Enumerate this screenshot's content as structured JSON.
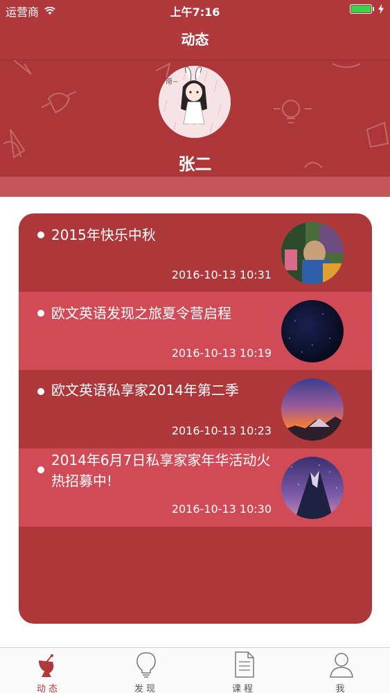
{
  "status_bar": {
    "carrier": "运营商",
    "time": "上午7:16",
    "battery_level": 1.0
  },
  "nav": {
    "title": "动态"
  },
  "profile": {
    "name": "张二"
  },
  "feed": [
    {
      "title": "2015年快乐中秋",
      "time": "2016-10-13 10:31"
    },
    {
      "title": "欧文英语发现之旅夏令营启程",
      "time": "2016-10-13 10:19"
    },
    {
      "title": "欧文英语私享家2014年第二季",
      "time": "2016-10-13 10:23"
    },
    {
      "title": "2014年6月7日私享家家年华活动火热招募中!",
      "time": "2016-10-13 10:30"
    }
  ],
  "tabs": [
    {
      "label": "动态",
      "icon": "satellite-dish-icon",
      "active": true
    },
    {
      "label": "发现",
      "icon": "lightbulb-icon",
      "active": false
    },
    {
      "label": "课程",
      "icon": "document-icon",
      "active": false
    },
    {
      "label": "我",
      "icon": "person-icon",
      "active": false
    }
  ],
  "colors": {
    "primary": "#b0393c",
    "card": "#ae373a",
    "card_alt": "#d14b57",
    "battery": "#39d34a"
  }
}
